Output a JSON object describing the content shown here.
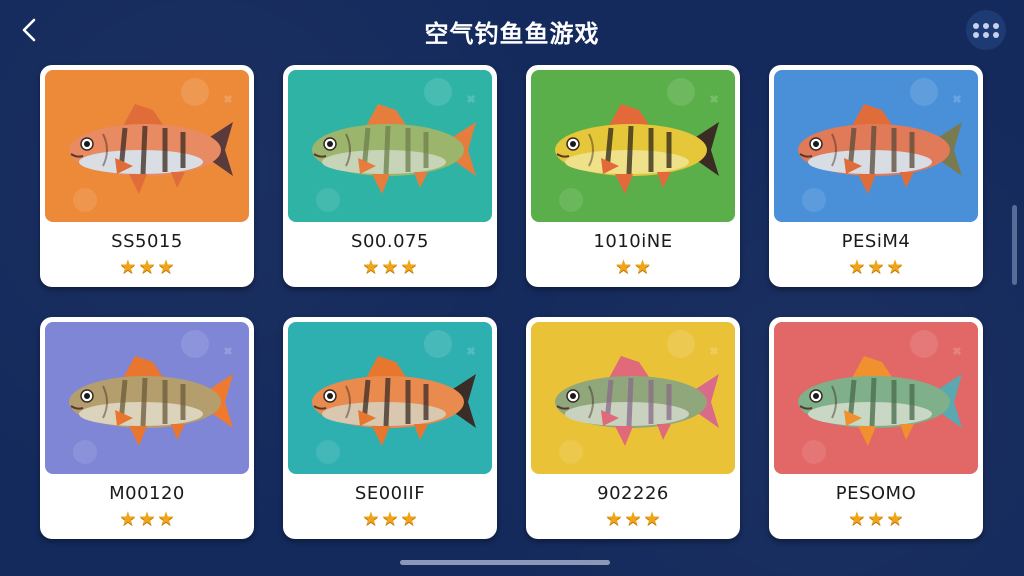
{
  "header": {
    "title": "空气钓鱼鱼游戏",
    "back_icon": "back-arrow-icon",
    "menu_icon": "grid-dots-icon"
  },
  "cards": [
    {
      "name": "SS5015",
      "rating": 3,
      "max_rating": 3,
      "bg": "#ec8a3a",
      "body": "#e88a62",
      "belly": "#d9dde4",
      "fin": "#e06c3a",
      "stripe": "#3a2a22",
      "tail": "#5a3a3a"
    },
    {
      "name": "S00.075",
      "rating": 3,
      "max_rating": 3,
      "bg": "#2fb3a5",
      "body": "#9bb66c",
      "belly": "#c7d4b8",
      "fin": "#e77d3d",
      "stripe": "#6d7f4c",
      "tail": "#e77d3d"
    },
    {
      "name": "1010iNE",
      "rating": 2,
      "max_rating": 2,
      "bg": "#5aaf4a",
      "body": "#e6c73a",
      "belly": "#efe08a",
      "fin": "#e4693a",
      "stripe": "#2a2418",
      "tail": "#3a2c22"
    },
    {
      "name": "PESiM4",
      "rating": 3,
      "max_rating": 3,
      "bg": "#4a90d9",
      "body": "#e07a58",
      "belly": "#d8dde4",
      "fin": "#e06c3a",
      "stripe": "#5a4a3a",
      "tail": "#7a7a50"
    },
    {
      "name": "M00120",
      "rating": 3,
      "max_rating": 3,
      "bg": "#7f86d6",
      "body": "#b59e6e",
      "belly": "#dcd3bd",
      "fin": "#e8762e",
      "stripe": "#6b5a3a",
      "tail": "#ef7a2e"
    },
    {
      "name": "SE00IIF",
      "rating": 3,
      "max_rating": 3,
      "bg": "#2fb0b0",
      "body": "#e98a4f",
      "belly": "#d9c7b0",
      "fin": "#e7762e",
      "stripe": "#3a2c26",
      "tail": "#3a2c26"
    },
    {
      "name": "902226",
      "rating": 3,
      "max_rating": 3,
      "bg": "#eac238",
      "body": "#8fa77a",
      "belly": "#c9d2bf",
      "fin": "#e06a7a",
      "stripe": "#8a6a8a",
      "tail": "#d96a8a"
    },
    {
      "name": "PESOMO",
      "rating": 3,
      "max_rating": 3,
      "bg": "#e26767",
      "body": "#7fb08a",
      "belly": "#c9d8c4",
      "fin": "#f0902e",
      "stripe": "#4a6a4a",
      "tail": "#5aa8b0"
    }
  ]
}
